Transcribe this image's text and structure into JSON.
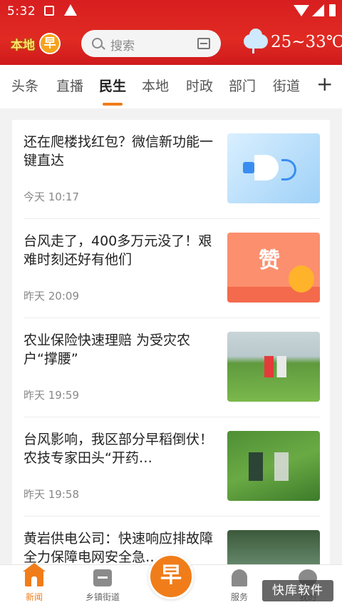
{
  "status_bar": {
    "time": "5:32"
  },
  "header": {
    "logo_text": "本地",
    "logo_badge": "早",
    "search_placeholder": "搜索",
    "weather_temp": "25~33℃"
  },
  "tabs": [
    {
      "label": "头条"
    },
    {
      "label": "直播"
    },
    {
      "label": "民生",
      "active": true
    },
    {
      "label": "本地"
    },
    {
      "label": "时政"
    },
    {
      "label": "部门"
    },
    {
      "label": "街道"
    }
  ],
  "tab_add": "+",
  "news": [
    {
      "title": "还在爬楼找红包？微信新功能一键直达",
      "time": "今天 10:17",
      "thumb": "megaphone-image"
    },
    {
      "title": "台风走了，400多万元没了！艰难时刻还好有他们",
      "time": "昨天 20:09",
      "thumb": "like-orange-image",
      "thumb_text": "赞"
    },
    {
      "title": "农业保险快速理赔 为受灾农户“撑腰”",
      "time": "昨天 19:59",
      "thumb": "rice-field-photo"
    },
    {
      "title": "台风影响，我区部分早稻倒伏！农技专家田头“开药…",
      "time": "昨天 19:58",
      "thumb": "experts-in-field-photo"
    },
    {
      "title": "黄岩供电公司：快速响应排故障 全力保障电网安全急…",
      "time": "",
      "thumb": "river-photo"
    }
  ],
  "bottom_nav": {
    "news": "新闻",
    "town": "乡镇街道",
    "center": "早",
    "service": "服务",
    "mine": "我的"
  },
  "watermark": "快库软件",
  "colors": {
    "header_red": "#d81e20",
    "accent_orange": "#f07d1a"
  }
}
